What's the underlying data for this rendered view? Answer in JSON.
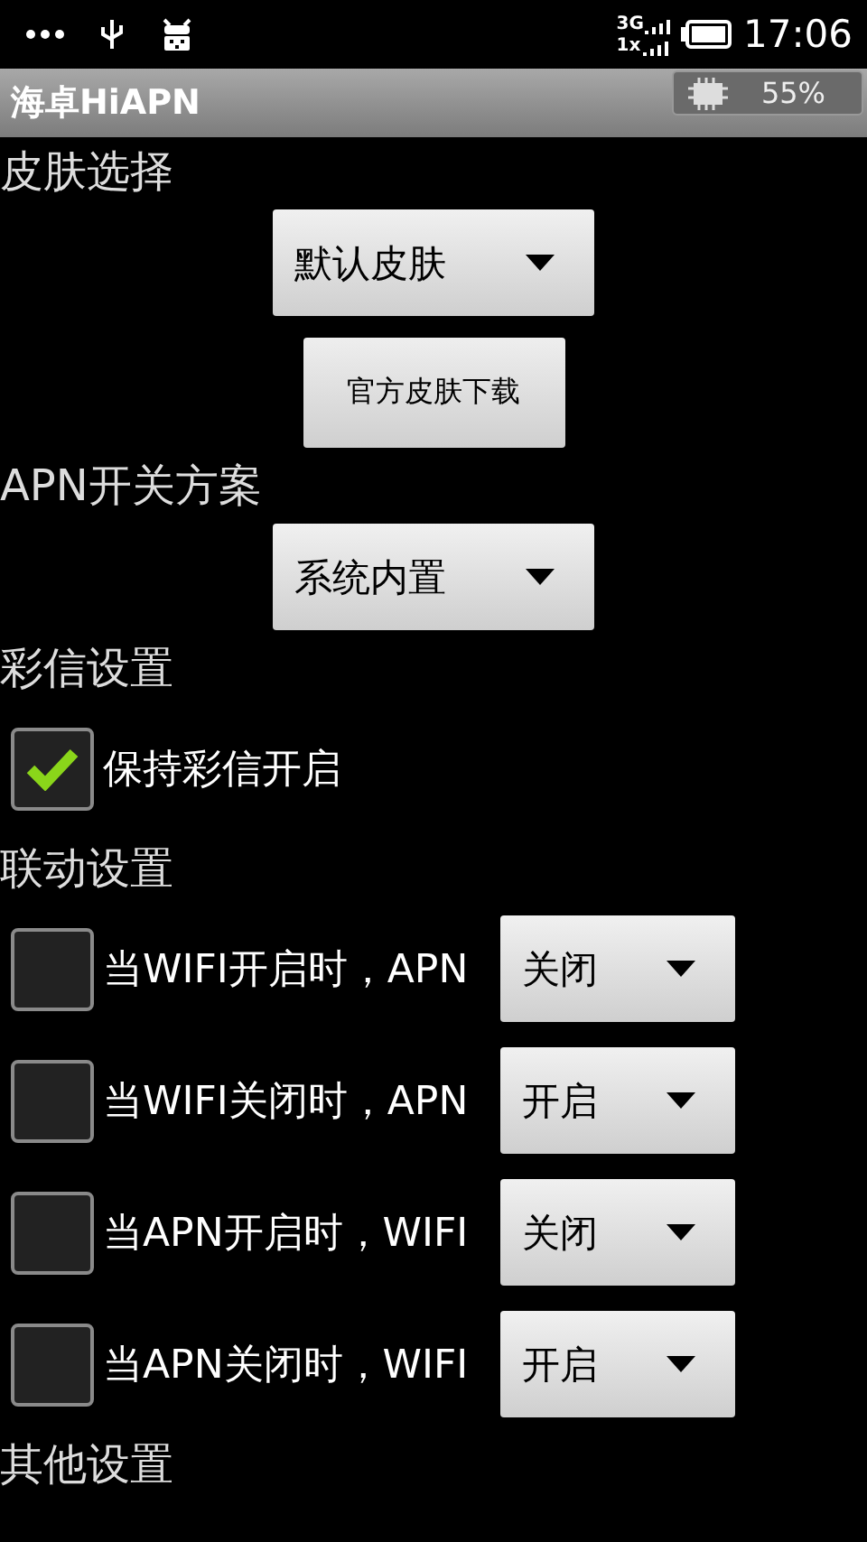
{
  "status_bar": {
    "network": [
      "3G",
      "1x"
    ],
    "time": "17:06"
  },
  "title_bar": {
    "title": "海卓HiAPN",
    "cpu_reading": "55%"
  },
  "sections": [
    {
      "heading": "皮肤选择",
      "items": [
        {
          "kind": "spinner",
          "value": "默认皮肤"
        },
        {
          "kind": "button",
          "label": "官方皮肤下载"
        }
      ]
    },
    {
      "heading": "APN开关方案",
      "items": [
        {
          "kind": "spinner",
          "value": "系统内置"
        }
      ]
    },
    {
      "heading": "彩信设置",
      "items": [
        {
          "kind": "checkbox",
          "label": "保持彩信开启",
          "checked": true
        }
      ]
    },
    {
      "heading": "联动设置",
      "items": [
        {
          "kind": "checkbox_spinner",
          "label": "当WIFI开启时，APN",
          "checked": false,
          "value": "关闭"
        },
        {
          "kind": "checkbox_spinner",
          "label": "当WIFI关闭时，APN",
          "checked": false,
          "value": "开启"
        },
        {
          "kind": "checkbox_spinner",
          "label": "当APN开启时，WIFI",
          "checked": false,
          "value": "关闭"
        },
        {
          "kind": "checkbox_spinner",
          "label": "当APN关闭时，WIFI",
          "checked": false,
          "value": "开启"
        }
      ]
    },
    {
      "heading": "其他设置"
    }
  ]
}
